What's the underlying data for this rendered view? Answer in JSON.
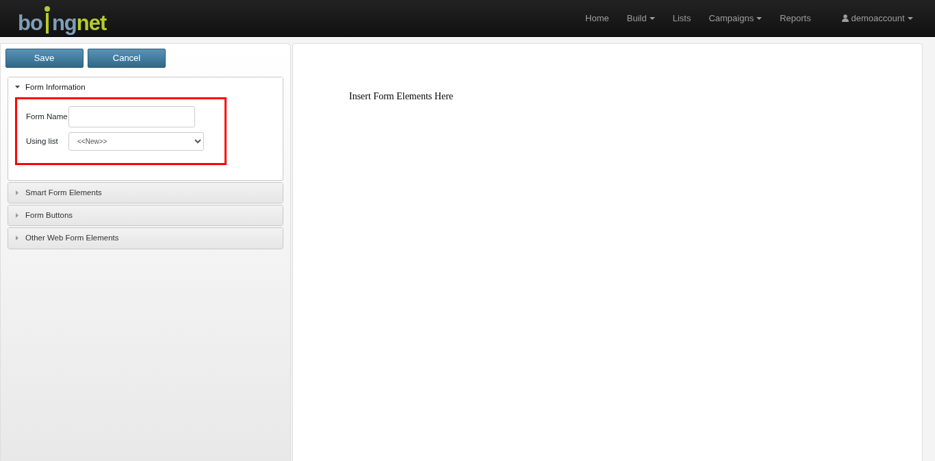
{
  "logo": {
    "left": "bo",
    "middle": "ng",
    "right": "net"
  },
  "nav": [
    {
      "label": "Home",
      "dropdown": false
    },
    {
      "label": "Build",
      "dropdown": true
    },
    {
      "label": "Lists",
      "dropdown": false
    },
    {
      "label": "Campaigns",
      "dropdown": true
    },
    {
      "label": "Reports",
      "dropdown": false
    }
  ],
  "account": {
    "label": "demoaccount",
    "dropdown": true
  },
  "buttons": [
    "Save",
    "Cancel"
  ],
  "sections": [
    {
      "title": "Form Information",
      "expanded": true,
      "fields": [
        {
          "label": "Form Name",
          "kind": "text"
        },
        {
          "label": "Using list",
          "kind": "select",
          "value": "<<New>>"
        }
      ]
    },
    {
      "title": "Smart Form Elements",
      "expanded": false
    },
    {
      "title": "Form Buttons",
      "expanded": false
    },
    {
      "title": "Other Web Form Elements",
      "expanded": false
    }
  ],
  "canvas": {
    "text": "Insert Form Elements Here"
  }
}
